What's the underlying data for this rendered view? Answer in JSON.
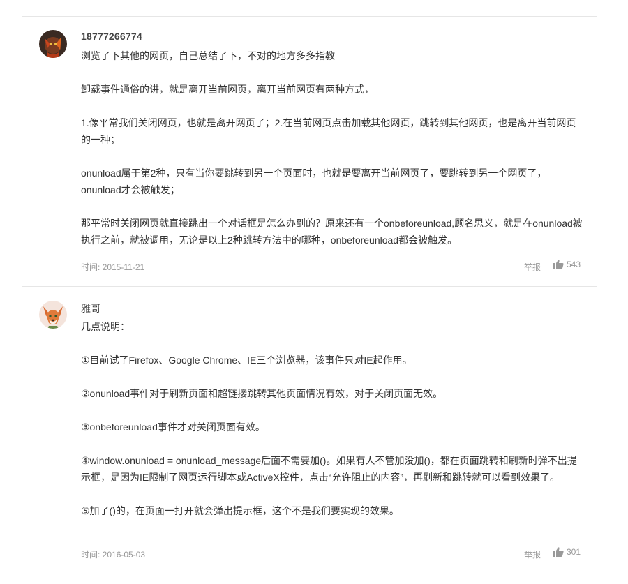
{
  "comments": [
    {
      "username": "18777266774",
      "paragraphs": [
        "浏览了下其他的网页，自己总结了下，不对的地方多多指教",
        "卸载事件通俗的讲，就是离开当前网页，离开当前网页有两种方式，",
        "1.像平常我们关闭网页，也就是离开网页了；2.在当前网页点击加载其他网页，跳转到其他网页，也是离开当前网页的一种；",
        "onunload属于第2种，只有当你要跳转到另一个页面时，也就是要离开当前网页了，要跳转到另一个网页了，onunload才会被触发；",
        "那平常时关闭网页就直接跳出一个对话框是怎么办到的？原来还有一个onbeforeunload,顾名思义，就是在onunload被执行之前，就被调用，无论是以上2种跳转方法中的哪种，onbeforeunload都会被触发。"
      ],
      "time": "时间: 2015-11-21",
      "report_label": "举报",
      "like_count": "543"
    },
    {
      "username": "雅哥",
      "paragraphs": [
        "几点说明：",
        "①目前试了Firefox、Google Chrome、IE三个浏览器，该事件只对IE起作用。",
        "②onunload事件对于刷新页面和超链接跳转其他页面情况有效，对于关闭页面无效。",
        "③onbeforeunload事件才对关闭页面有效。",
        "④window.onunload = onunload_message后面不需要加()。如果有人不管加没加()，都在页面跳转和刷新时弹不出提示框，是因为IE限制了网页运行脚本或ActiveX控件，点击“允许阻止的内容”，再刷新和跳转就可以看到效果了。",
        "⑤加了()的，在页面一打开就会弹出提示框，这个不是我们要实现的效果。"
      ],
      "time": "时间: 2016-05-03",
      "report_label": "举报",
      "like_count": "301"
    }
  ],
  "icons": {
    "like": "thumbs-up-icon"
  },
  "colors": {
    "meta_text": "#999999",
    "divider": "#e6e6e6",
    "body_text": "#333333"
  }
}
